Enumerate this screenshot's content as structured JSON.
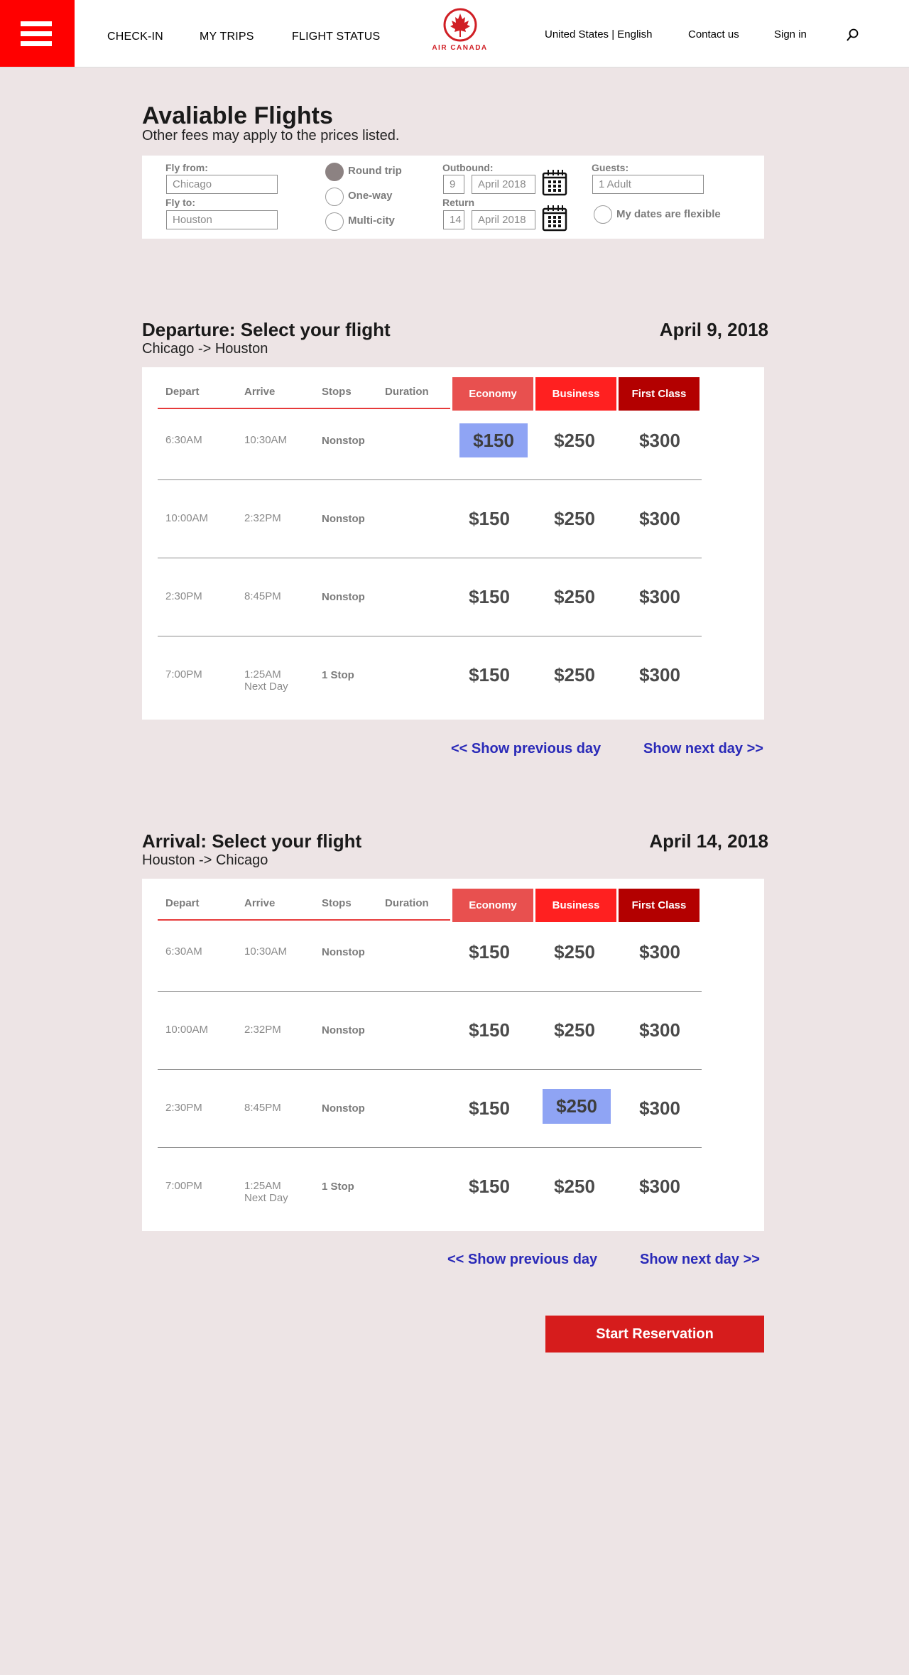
{
  "colors": {
    "brand_red": "#ff0000",
    "logo_red": "#d01f25",
    "economy": "#e8504f",
    "business": "#ff2020",
    "first_class": "#b30000",
    "selected_price": "#8fa4f4",
    "link": "#2a2ab8",
    "cta": "#d61c1c"
  },
  "header": {
    "menu_icon": "hamburger-icon",
    "nav": [
      "CHECK-IN",
      "MY TRIPS",
      "FLIGHT STATUS"
    ],
    "logo_text": "AIR CANADA",
    "logo_icon": "maple-leaf-icon",
    "locale": "United States | English",
    "contact": "Contact us",
    "signin": "Sign in",
    "search_icon": "search-icon"
  },
  "page": {
    "title": "Avaliable Flights",
    "subtitle": "Other fees may apply to the prices listed."
  },
  "search": {
    "fly_from_label": "Fly from:",
    "fly_from_value": "Chicago",
    "fly_to_label": "Fly to:",
    "fly_to_value": "Houston",
    "trip_types": [
      {
        "label": "Round trip",
        "selected": true
      },
      {
        "label": "One-way",
        "selected": false
      },
      {
        "label": "Multi-city",
        "selected": false
      }
    ],
    "outbound_label": "Outbound:",
    "outbound_day": "9",
    "outbound_month": "April 2018",
    "return_label": "Return",
    "return_day": "14",
    "return_month": "April 2018",
    "calendar_icon": "calendar-icon",
    "guests_label": "Guests:",
    "guests_value": "1 Adult",
    "flexible_label": "My dates are flexible"
  },
  "columns": {
    "depart": "Depart",
    "arrive": "Arrive",
    "stops": "Stops",
    "duration": "Duration"
  },
  "classes": [
    "Economy",
    "Business",
    "First Class"
  ],
  "departure": {
    "title": "Departure: Select your flight",
    "route": "Chicago -> Houston",
    "date": "April 9, 2018",
    "flights": [
      {
        "depart": "6:30AM",
        "arrive": "10:30AM",
        "arrive_note": "",
        "stops": "Nonstop",
        "prices": [
          "$150",
          "$250",
          "$300"
        ],
        "selected": 0
      },
      {
        "depart": "10:00AM",
        "arrive": "2:32PM",
        "arrive_note": "",
        "stops": "Nonstop",
        "prices": [
          "$150",
          "$250",
          "$300"
        ],
        "selected": -1
      },
      {
        "depart": "2:30PM",
        "arrive": "8:45PM",
        "arrive_note": "",
        "stops": "Nonstop",
        "prices": [
          "$150",
          "$250",
          "$300"
        ],
        "selected": -1
      },
      {
        "depart": "7:00PM",
        "arrive": "1:25AM",
        "arrive_note": "Next Day",
        "stops": "1 Stop",
        "prices": [
          "$150",
          "$250",
          "$300"
        ],
        "selected": -1
      }
    ],
    "prev_day": "<< Show previous day",
    "next_day": "Show next day >>"
  },
  "arrival": {
    "title": "Arrival: Select your flight",
    "route": "Houston -> Chicago",
    "date": "April 14, 2018",
    "flights": [
      {
        "depart": "6:30AM",
        "arrive": "10:30AM",
        "arrive_note": "",
        "stops": "Nonstop",
        "prices": [
          "$150",
          "$250",
          "$300"
        ],
        "selected": -1
      },
      {
        "depart": "10:00AM",
        "arrive": "2:32PM",
        "arrive_note": "",
        "stops": "Nonstop",
        "prices": [
          "$150",
          "$250",
          "$300"
        ],
        "selected": -1
      },
      {
        "depart": "2:30PM",
        "arrive": "8:45PM",
        "arrive_note": "",
        "stops": "Nonstop",
        "prices": [
          "$150",
          "$250",
          "$300"
        ],
        "selected": 1
      },
      {
        "depart": "7:00PM",
        "arrive": "1:25AM",
        "arrive_note": "Next Day",
        "stops": "1 Stop",
        "prices": [
          "$150",
          "$250",
          "$300"
        ],
        "selected": -1
      }
    ],
    "prev_day": "<< Show previous day",
    "next_day": "Show next day >>"
  },
  "cta": "Start Reservation"
}
